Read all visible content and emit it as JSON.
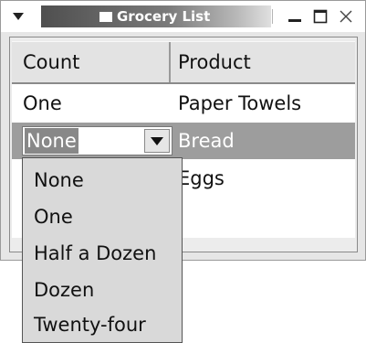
{
  "window": {
    "title": "Grocery List",
    "menu_icon": "triangle-down-icon",
    "controls": [
      "minimize-icon",
      "maximize-icon",
      "close-icon"
    ]
  },
  "table": {
    "headers": [
      "Count",
      "Product"
    ],
    "rows": [
      {
        "count": "One",
        "product": "Paper Towels"
      },
      {
        "count": "None",
        "product": "Bread"
      },
      {
        "count": "",
        "product": "Eggs"
      }
    ],
    "selected_row": 1
  },
  "combo": {
    "value": "None",
    "options": [
      "None",
      "One",
      "Half a Dozen",
      "Dozen",
      "Twenty-four"
    ]
  },
  "colors": {
    "selection": "#9d9d9d",
    "title_gradient_start": "#4f4f4f",
    "dropdown_bg": "#d9d9d9"
  }
}
